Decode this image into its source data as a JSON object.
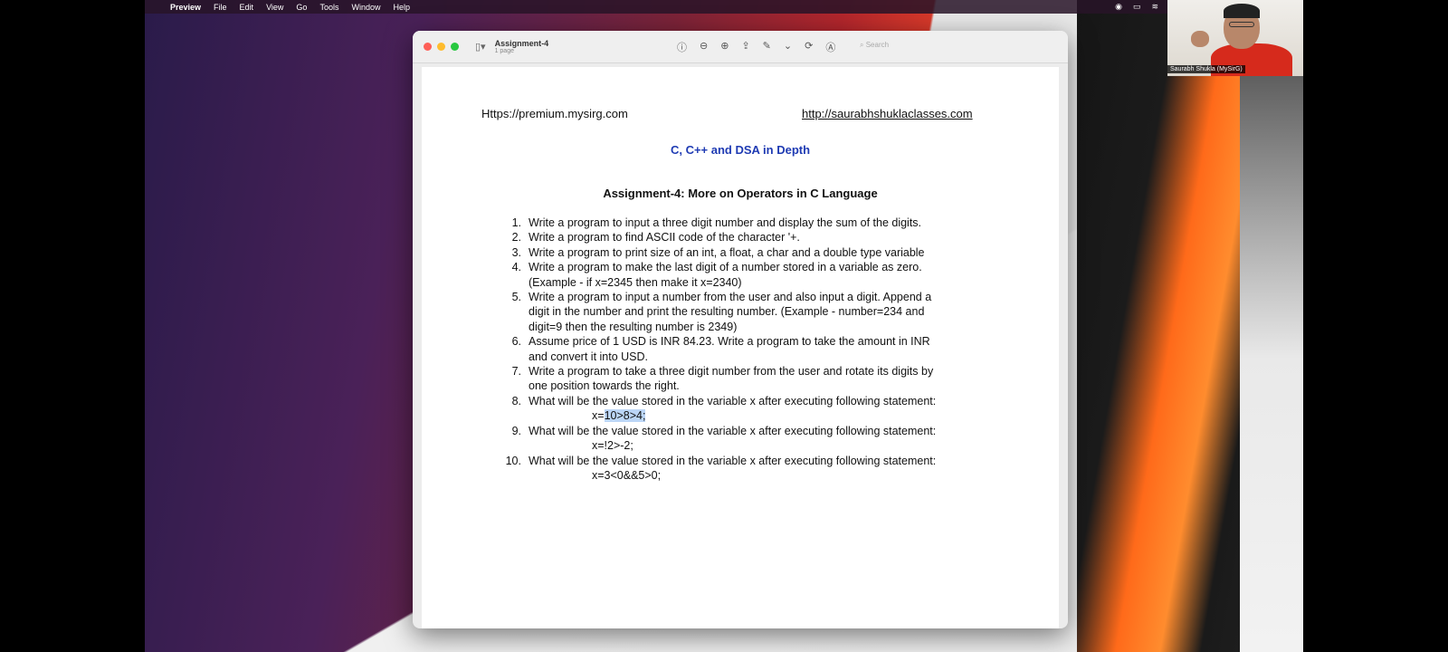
{
  "menubar": {
    "app": "Preview",
    "items": [
      "File",
      "Edit",
      "View",
      "Go",
      "Tools",
      "Window",
      "Help"
    ]
  },
  "video": {
    "caption": "Saurabh Shukla (MySirG)"
  },
  "window": {
    "title": "Assignment-4",
    "subtitle": "1 page",
    "search_placeholder": "Search"
  },
  "document": {
    "link_left": "Https://premium.mysirg.com",
    "link_right": "http://saurabhshuklaclasses.com",
    "course_title": "C, C++ and DSA in Depth",
    "assignment_title": "Assignment-4: More on Operators in C Language",
    "questions": [
      {
        "num": "1.",
        "lines": [
          "Write a program to input a three digit number and display the sum of the digits."
        ]
      },
      {
        "num": "2.",
        "lines": [
          "Write a program to find ASCII code of the character '+."
        ]
      },
      {
        "num": "3.",
        "lines": [
          "Write a program to print size of an int, a float, a char and a double type variable"
        ]
      },
      {
        "num": "4.",
        "lines": [
          "Write a program to make the last digit of a number stored in a variable as zero.",
          "(Example - if x=2345 then make it x=2340)"
        ]
      },
      {
        "num": "5.",
        "lines": [
          "Write a program to input a number from the user and also input a digit. Append a",
          "digit in the number and print the resulting number. (Example - number=234 and",
          "digit=9 then the resulting number is 2349)"
        ]
      },
      {
        "num": "6.",
        "lines": [
          "Assume price of 1 USD is INR 84.23. Write a program to take the amount in INR",
          "and convert it into USD."
        ]
      },
      {
        "num": "7.",
        "lines": [
          "Write a program to take a three digit number from the user and rotate its digits by",
          "one position towards the right."
        ]
      },
      {
        "num": "8.",
        "lines": [
          "What will be the value stored in the variable x after executing following statement:"
        ],
        "code_prefix": "x=",
        "code_highlight": "10>8>4;"
      },
      {
        "num": "9.",
        "lines": [
          "What will be the value stored in the variable x after executing following statement:"
        ],
        "code": "x=!2>-2;"
      },
      {
        "num": "10.",
        "lines": [
          "What will be the value stored in the variable x after executing following statement:"
        ],
        "code": "x=3<0&&5>0;"
      }
    ]
  }
}
